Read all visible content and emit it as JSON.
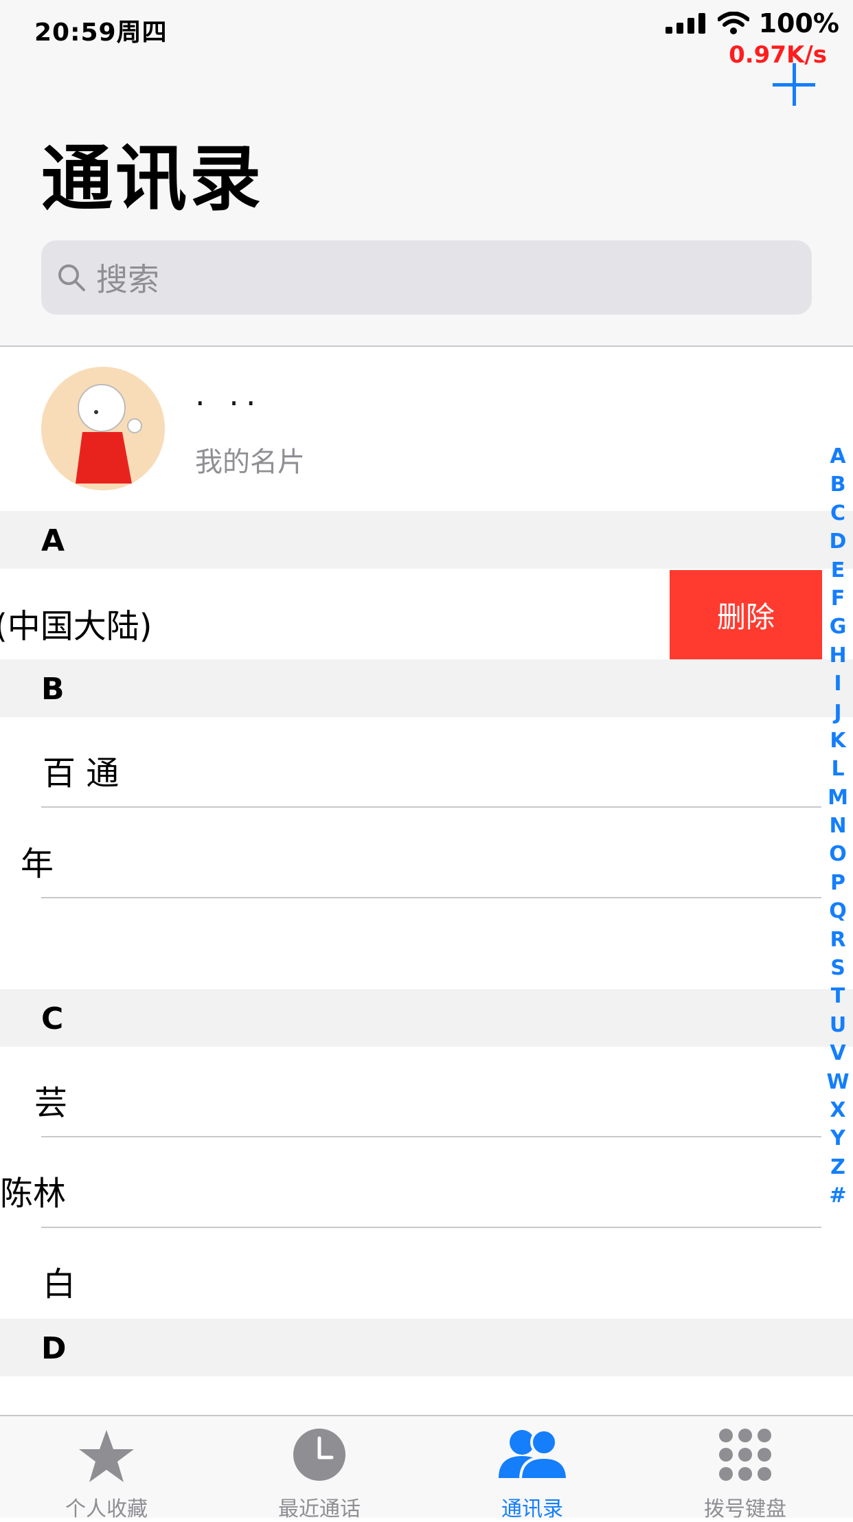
{
  "status_bar": {
    "time": "20:59周四",
    "battery": "100%",
    "net_speed": "0.97K/s"
  },
  "header": {
    "title": "通讯录",
    "add_icon": "plus-icon"
  },
  "search": {
    "placeholder": "搜索"
  },
  "my_card": {
    "name": "· ·· ",
    "label": "我的名片"
  },
  "sections": [
    {
      "letter": "A",
      "rows": [
        "(中国大陆)"
      ]
    },
    {
      "letter": "B",
      "rows": [
        "百  通",
        "  年  ",
        "  "
      ]
    },
    {
      "letter": "C",
      "rows": [
        "芸",
        "陈林",
        "白"
      ]
    },
    {
      "letter": "D",
      "rows": []
    }
  ],
  "swipe_action": {
    "delete_label": "删除"
  },
  "index_letters": [
    "A",
    "B",
    "C",
    "D",
    "E",
    "F",
    "G",
    "H",
    "I",
    "J",
    "K",
    "L",
    "M",
    "N",
    "O",
    "P",
    "Q",
    "R",
    "S",
    "T",
    "U",
    "V",
    "W",
    "X",
    "Y",
    "Z",
    "#"
  ],
  "tabbar": {
    "tabs": [
      {
        "label": "个人收藏",
        "icon": "star-icon"
      },
      {
        "label": "最近通话",
        "icon": "clock-icon"
      },
      {
        "label": "通讯录",
        "icon": "contacts-icon",
        "active": true
      },
      {
        "label": "拨号键盘",
        "icon": "keypad-icon"
      }
    ]
  },
  "colors": {
    "accent": "#147efb",
    "delete": "#ff3b30",
    "net_speed": "#ff1d1d"
  }
}
